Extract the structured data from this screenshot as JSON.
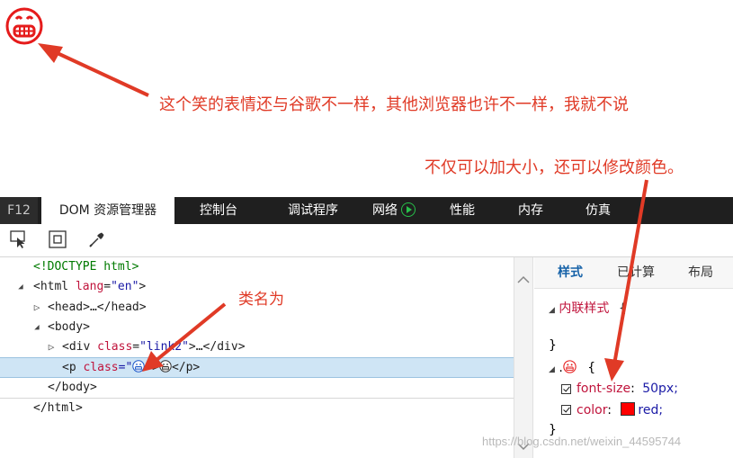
{
  "annotations": {
    "top_note": "这个笑的表情还与谷歌不一样，其他浏览器也许不一样，我就不说",
    "mid_note": "不仅可以加大小，还可以修改颜色。",
    "class_note": "类名为"
  },
  "tabs": {
    "f12": "F12",
    "dom": "DOM 资源管理器",
    "console": "控制台",
    "debugger": "调试程序",
    "network": "网络",
    "performance": "性能",
    "memory": "内存",
    "emulation": "仿真"
  },
  "icons": {
    "select": "select-element-icon",
    "box": "box-model-icon",
    "eyedropper": "eyedropper-icon",
    "play": "play-icon"
  },
  "dom_tree": {
    "doctype": "<!DOCTYPE html>",
    "html_open_tag": "<html",
    "html_attr": "lang",
    "html_val": "\"en\"",
    "html_close": ">",
    "head": "<head>…</head>",
    "body_open": "<body>",
    "div_open": "<div",
    "div_attr": "class",
    "div_val": "\"link2\"",
    "div_rest": ">…</div>",
    "p_open": "<p",
    "p_attr": "class",
    "p_eq": "=\"",
    "p_quote": "\"",
    "p_close": ">",
    "p_end": "</p>",
    "body_close": "</body>",
    "html_close_tag": "</html>"
  },
  "styles_pane": {
    "tabs": [
      "样式",
      "已计算",
      "布局"
    ],
    "inline_label": "内联样式",
    "inline_mark": "{",
    "close_brace": "}",
    "selector_dot": ".",
    "open_brace": "{",
    "rules": [
      {
        "prop": "font-size",
        "colon": ":",
        "value": "50px;"
      },
      {
        "prop": "color",
        "colon": ":",
        "value": "red;",
        "swatch": "#ff0000"
      }
    ],
    "end_brace": "}"
  },
  "watermark": "https://blog.csdn.net/weixin_44595744",
  "colors": {
    "annotation": "#e03a26",
    "tabbar": "#1f1f1f",
    "selected_row": "#cfe5f5",
    "active_pane_tab": "#1662a8"
  }
}
